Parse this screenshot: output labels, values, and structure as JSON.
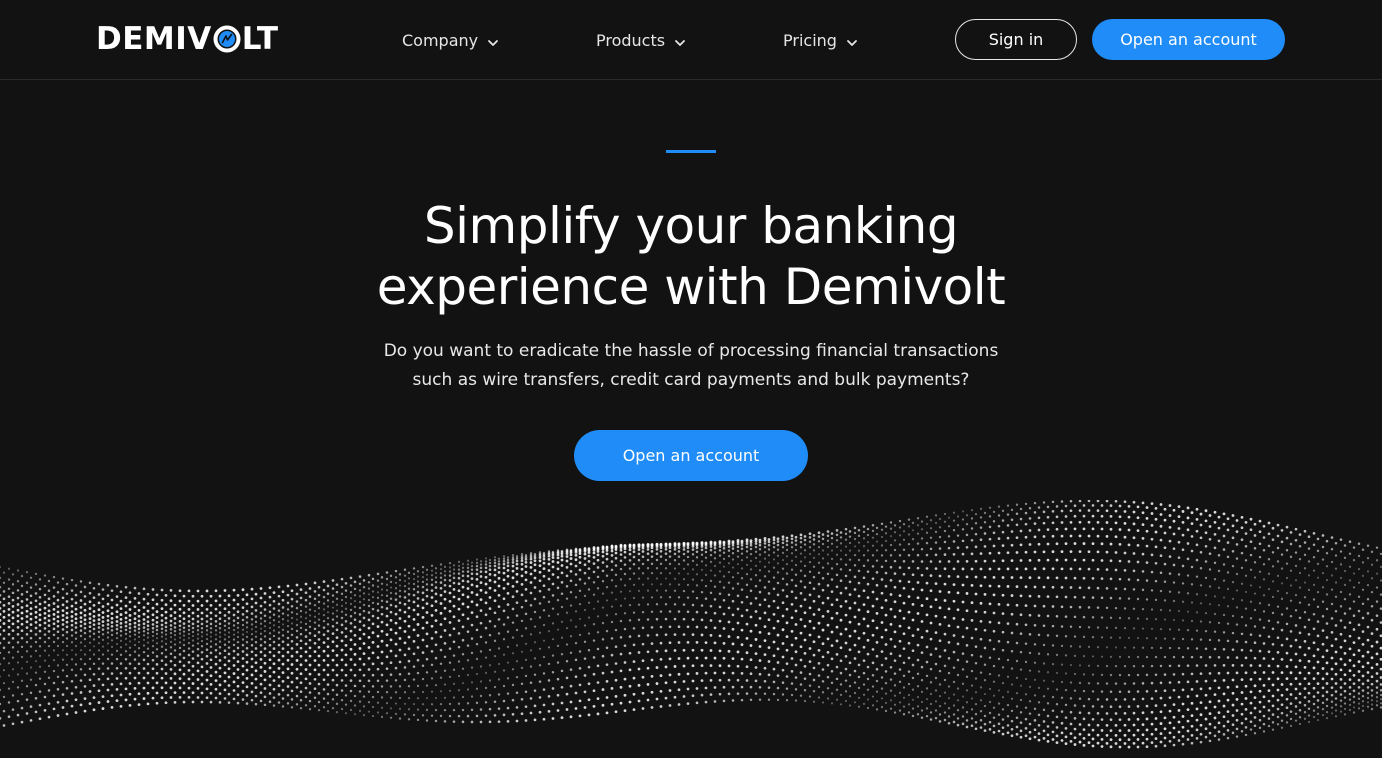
{
  "brand": {
    "name_left": "DEMIV",
    "name_right": "LT",
    "accent_color": "#1f8cf8",
    "logo_icon": "bolt-circle-icon"
  },
  "nav": {
    "items": [
      {
        "label": "Company",
        "icon": "chevron-down-icon"
      },
      {
        "label": "Products",
        "icon": "chevron-down-icon"
      },
      {
        "label": "Pricing",
        "icon": "chevron-down-icon"
      }
    ],
    "sign_in_label": "Sign in",
    "open_account_label": "Open an account"
  },
  "hero": {
    "title_line1": "Simplify your banking",
    "title_line2": "experience with Demivolt",
    "subtitle_line1": "Do you want to eradicate the hassle of processing financial transactions",
    "subtitle_line2": "such as wire transfers, credit card payments and bulk payments?",
    "cta_label": "Open an account"
  },
  "colors": {
    "background": "#121212",
    "primary": "#1f8cf8",
    "text": "#ffffff"
  }
}
